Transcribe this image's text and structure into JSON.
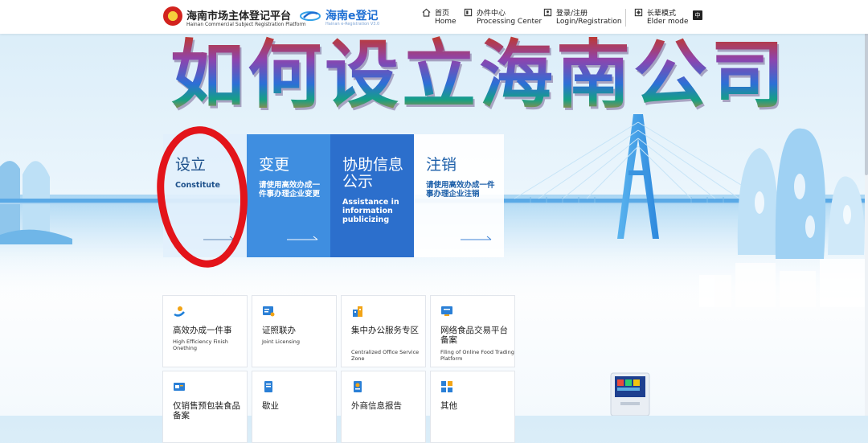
{
  "header": {
    "brand_cn": "海南市场主体登记平台",
    "brand_en": "Hainan Commercial Subject Registration Platform",
    "ereg_cn": "海南e登记",
    "ereg_en": "Hainan e-Registration V3.0",
    "nav": [
      {
        "cn": "首页",
        "en": "Home",
        "icon": "home-icon"
      },
      {
        "cn": "办件中心",
        "en": "Processing Center",
        "icon": "document-icon"
      },
      {
        "cn": "登录/注册",
        "en": "Login/Registration",
        "icon": "user-icon"
      },
      {
        "cn": "长辈模式",
        "en": "Elder mode",
        "icon": "elder-mode-icon"
      }
    ],
    "lang_icon": "language-switch-icon",
    "lang_glyph": "中"
  },
  "hero": {
    "title": "如何设立海南公司"
  },
  "cards": [
    {
      "title": "设立",
      "subtitle": "Constitute"
    },
    {
      "title": "变更",
      "subtitle": "请使用高效办成一件事办理企业变更"
    },
    {
      "title": "协助信息公示",
      "subtitle": "Assistance in information publicizing"
    },
    {
      "title": "注销",
      "subtitle": "请使用高效办成一件事办理企业注销"
    }
  ],
  "services": [
    {
      "cn": "高效办成一件事",
      "en": "High Efficiency Finish Onething",
      "icon": "efficiency-icon"
    },
    {
      "cn": "证照联办",
      "en": "Joint Licensing",
      "icon": "license-icon"
    },
    {
      "cn": "集中办公服务专区",
      "en": "Centralized Office Service Zone",
      "icon": "office-icon"
    },
    {
      "cn": "网络食品交易平台备案",
      "en": "Filing of Online Food Trading Platform",
      "icon": "monitor-icon"
    },
    {
      "cn": "仅销售预包装食品备案",
      "en": "",
      "icon": "food-filing-icon"
    },
    {
      "cn": "歇业",
      "en": "",
      "icon": "suspend-icon"
    },
    {
      "cn": "外商信息报告",
      "en": "",
      "icon": "foreign-report-icon"
    },
    {
      "cn": "其他",
      "en": "",
      "icon": "grid-icon"
    }
  ],
  "colors": {
    "accent": "#2c6fcc",
    "card_blue": "#3f8ee0",
    "annotation_red": "#e3141a"
  }
}
